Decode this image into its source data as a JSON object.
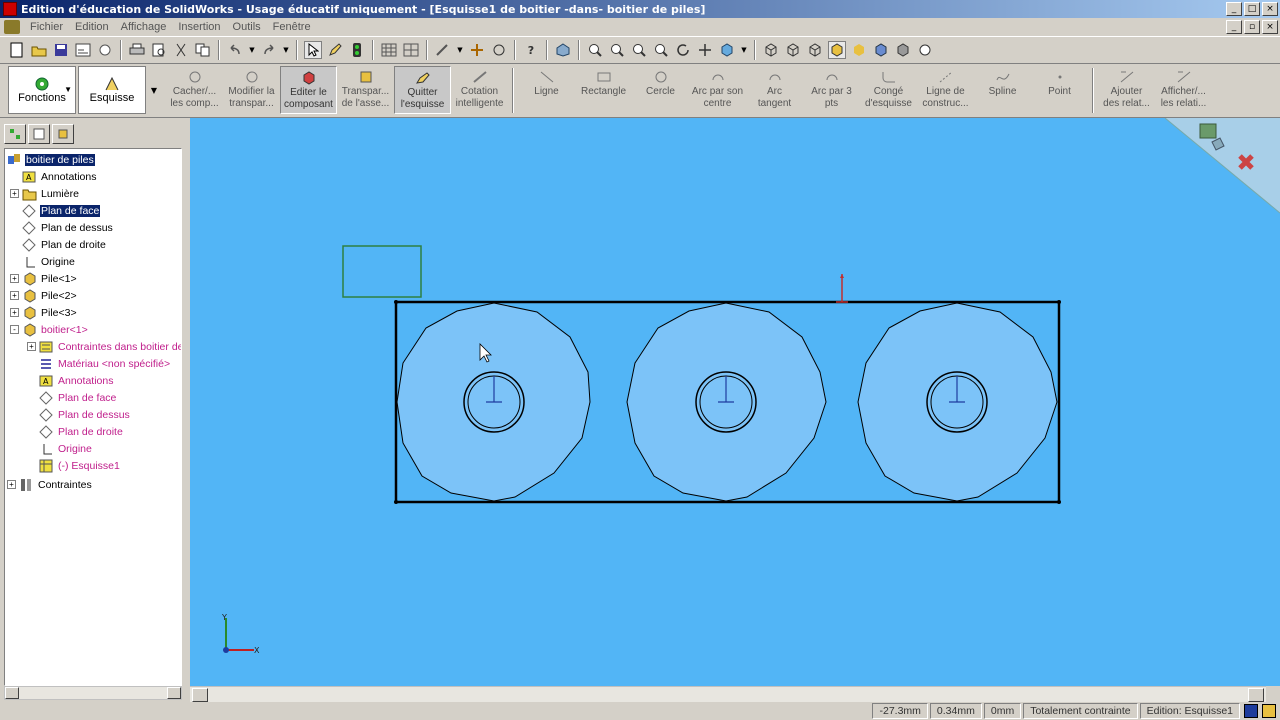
{
  "window": {
    "title": "Edition d'éducation de SolidWorks - Usage éducatif uniquement - [Esquisse1 de boitier -dans- boitier de piles]"
  },
  "menu": {
    "items": [
      "Fichier",
      "Edition",
      "Affichage",
      "Insertion",
      "Outils",
      "Fenêtre"
    ]
  },
  "command_manager": {
    "fonctions_label": "Fonctions",
    "esquisse_label": "Esquisse",
    "buttons": [
      {
        "label": "Cacher/...\nles comp...",
        "icon": "hide-components-icon"
      },
      {
        "label": "Modifier la\ntranspar...",
        "icon": "transparency-icon"
      },
      {
        "label": "Editer le\ncomposant",
        "icon": "edit-component-icon"
      },
      {
        "label": "Transpar...\nde l'asse...",
        "icon": "assembly-transparency-icon"
      },
      {
        "label": "Quitter\nl'esquisse",
        "icon": "exit-sketch-icon"
      },
      {
        "label": "Cotation\nintelligente",
        "icon": "smart-dimension-icon"
      },
      {
        "label": "Ligne",
        "icon": "line-icon"
      },
      {
        "label": "Rectangle",
        "icon": "rectangle-icon"
      },
      {
        "label": "Cercle",
        "icon": "circle-icon"
      },
      {
        "label": "Arc par son\ncentre",
        "icon": "centerpoint-arc-icon"
      },
      {
        "label": "Arc\ntangent",
        "icon": "tangent-arc-icon"
      },
      {
        "label": "Arc par 3\npts",
        "icon": "three-point-arc-icon"
      },
      {
        "label": "Congé\nd'esquisse",
        "icon": "sketch-fillet-icon"
      },
      {
        "label": "Ligne de\nconstruc...",
        "icon": "construction-line-icon"
      },
      {
        "label": "Spline",
        "icon": "spline-icon"
      },
      {
        "label": "Point",
        "icon": "point-icon"
      },
      {
        "label": "Ajouter\ndes relat...",
        "icon": "add-relation-icon"
      },
      {
        "label": "Afficher/...\nles relati...",
        "icon": "display-relations-icon"
      }
    ]
  },
  "feature_tree": {
    "items": [
      {
        "label": "boitier de piles",
        "level": 0,
        "expander": "",
        "icon": "assembly-icon",
        "selected": true,
        "magenta": false
      },
      {
        "label": "Annotations",
        "level": 1,
        "expander": "",
        "icon": "annotations-icon",
        "selected": false,
        "magenta": false
      },
      {
        "label": "Lumière",
        "level": 1,
        "expander": "+",
        "icon": "lights-folder-icon",
        "selected": false,
        "magenta": false
      },
      {
        "label": "Plan de face",
        "level": 1,
        "expander": "",
        "icon": "plane-icon",
        "selected": true,
        "magenta": false
      },
      {
        "label": "Plan de dessus",
        "level": 1,
        "expander": "",
        "icon": "plane-icon",
        "selected": false,
        "magenta": false
      },
      {
        "label": "Plan de droite",
        "level": 1,
        "expander": "",
        "icon": "plane-icon",
        "selected": false,
        "magenta": false
      },
      {
        "label": "Origine",
        "level": 1,
        "expander": "",
        "icon": "origin-icon",
        "selected": false,
        "magenta": false
      },
      {
        "label": "Pile<1>",
        "level": 1,
        "expander": "+",
        "icon": "part-icon",
        "selected": false,
        "magenta": false
      },
      {
        "label": "Pile<2>",
        "level": 1,
        "expander": "+",
        "icon": "part-icon",
        "selected": false,
        "magenta": false
      },
      {
        "label": "Pile<3>",
        "level": 1,
        "expander": "+",
        "icon": "part-icon",
        "selected": false,
        "magenta": false
      },
      {
        "label": "boitier<1>",
        "level": 1,
        "expander": "-",
        "icon": "part-icon",
        "selected": false,
        "magenta": true
      },
      {
        "label": "Contraintes dans boitier de",
        "level": 2,
        "expander": "+",
        "icon": "mates-folder-icon",
        "selected": false,
        "magenta": true
      },
      {
        "label": "Matériau <non spécifié>",
        "level": 2,
        "expander": "",
        "icon": "material-icon",
        "selected": false,
        "magenta": true
      },
      {
        "label": "Annotations",
        "level": 2,
        "expander": "",
        "icon": "annotations-icon",
        "selected": false,
        "magenta": true
      },
      {
        "label": "Plan de face",
        "level": 2,
        "expander": "",
        "icon": "plane-icon",
        "selected": false,
        "magenta": true
      },
      {
        "label": "Plan de dessus",
        "level": 2,
        "expander": "",
        "icon": "plane-icon",
        "selected": false,
        "magenta": true
      },
      {
        "label": "Plan de droite",
        "level": 2,
        "expander": "",
        "icon": "plane-icon",
        "selected": false,
        "magenta": true
      },
      {
        "label": "Origine",
        "level": 2,
        "expander": "",
        "icon": "origin-icon",
        "selected": false,
        "magenta": true
      },
      {
        "label": "(-) Esquisse1",
        "level": 2,
        "expander": "",
        "icon": "sketch-icon",
        "selected": false,
        "magenta": true
      },
      {
        "label": "Contraintes",
        "level": 0,
        "expander": "+",
        "icon": "mates-icon",
        "selected": false,
        "magenta": false
      }
    ]
  },
  "viewport": {
    "background": "#52b5f6",
    "axis_x_label": "X",
    "axis_y_label": "Y"
  },
  "status_bar": {
    "x": "-27.3mm",
    "y": "0.34mm",
    "z": "0mm",
    "state": "Totalement contrainte",
    "edit": "Edition: Esquisse1"
  }
}
